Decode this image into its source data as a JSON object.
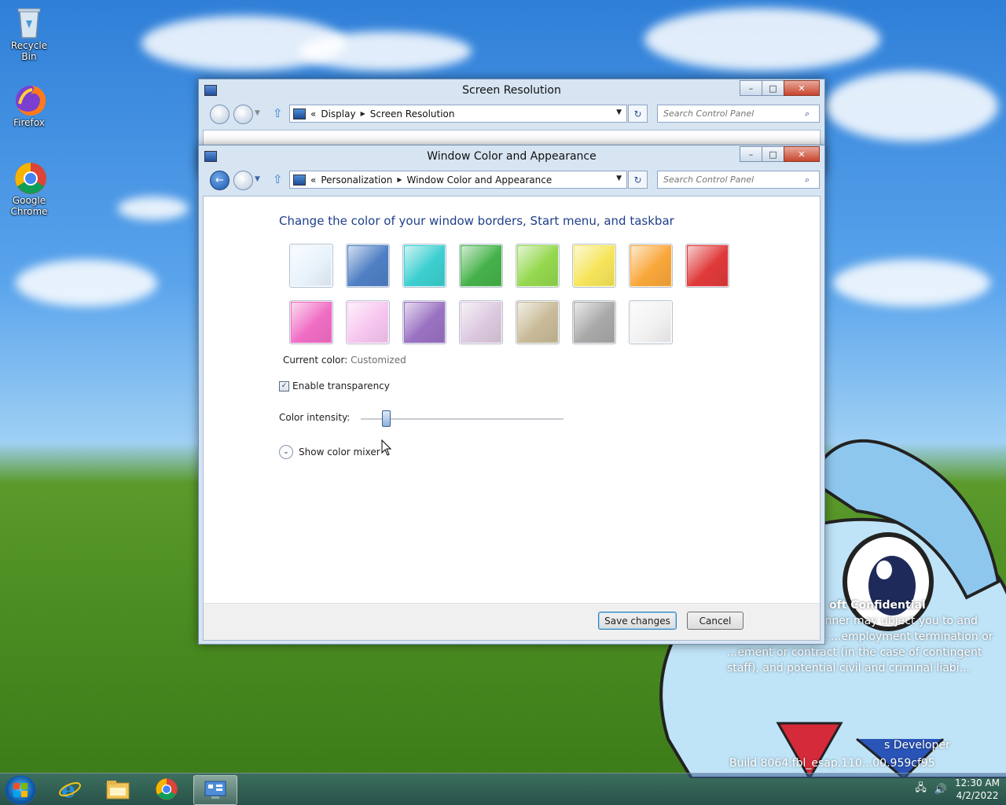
{
  "desktop": {
    "icons": [
      {
        "label": "Recycle Bin"
      },
      {
        "label": "Firefox"
      },
      {
        "label": "Google Chrome"
      }
    ],
    "watermark_confidential": {
      "title": "oft Confidential",
      "body": "closure in any manner may ubject you to and including termin... ...employment termination or ...ement or contract (in the case of contingent staff), and potential civil and criminal liabi..."
    },
    "watermark_dev": "s Developer",
    "watermark_build": "Build 8064.fbl_esap.110...00.959cf95"
  },
  "window_back": {
    "title": "Screen Resolution",
    "address": [
      "Display",
      "Screen Resolution"
    ],
    "search_placeholder": "Search Control Panel"
  },
  "window_front": {
    "title": "Window Color and Appearance",
    "address": [
      "Personalization",
      "Window Color and Appearance"
    ],
    "search_placeholder": "Search Control Panel",
    "heading": "Change the color of your window borders, Start menu, and taskbar",
    "swatches_row1": [
      {
        "name": "sky",
        "color": "#e9f3fc"
      },
      {
        "name": "twilight",
        "color": "#4f7fc4"
      },
      {
        "name": "sea",
        "color": "#3ccfd0"
      },
      {
        "name": "leaf",
        "color": "#46b24a"
      },
      {
        "name": "lime",
        "color": "#94d84e"
      },
      {
        "name": "sun",
        "color": "#f6e55b"
      },
      {
        "name": "pumpkin",
        "color": "#f9a73a"
      },
      {
        "name": "ruby",
        "color": "#e03a3a"
      }
    ],
    "swatches_row2": [
      {
        "name": "fuchsia",
        "color": "#f06ec4"
      },
      {
        "name": "blush",
        "color": "#f7c6ef"
      },
      {
        "name": "violet",
        "color": "#9a72c2"
      },
      {
        "name": "lavender",
        "color": "#dcc9df"
      },
      {
        "name": "taupe",
        "color": "#c9bb98"
      },
      {
        "name": "chocolate",
        "color": "#a9a9a9"
      },
      {
        "name": "frost",
        "color": "#f2f2f2"
      }
    ],
    "current_color_label": "Current color:",
    "current_color_value": "Customized",
    "transparency_label": "Enable transparency",
    "transparency_checked": true,
    "intensity_label": "Color intensity:",
    "intensity_fraction": 0.12,
    "mixer_label": "Show color mixer",
    "save_label": "Save changes",
    "cancel_label": "Cancel"
  },
  "taskbar": {
    "time": "12:30 AM",
    "date": "4/2/2022"
  }
}
